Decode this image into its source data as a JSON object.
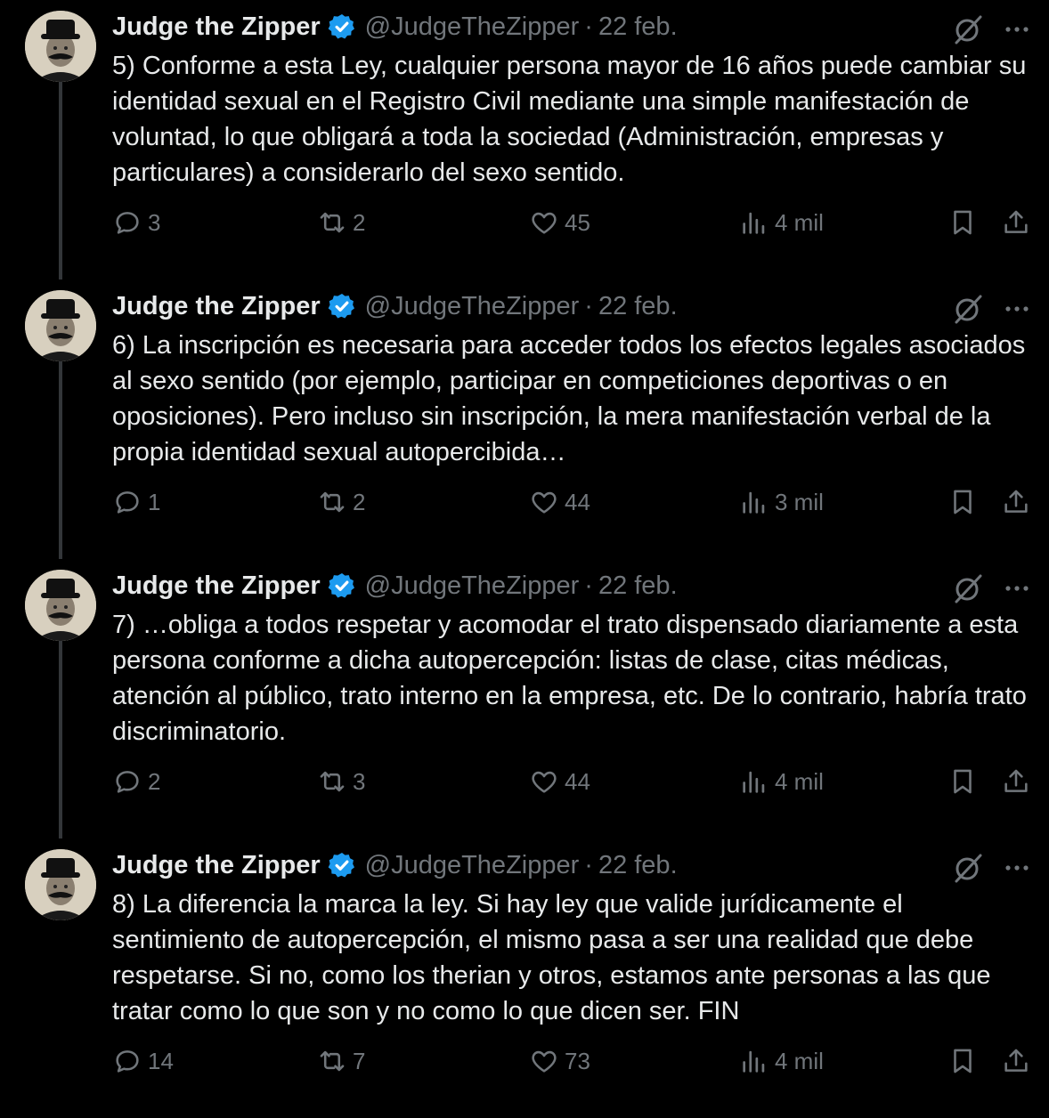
{
  "tweets": [
    {
      "name": "Judge the Zipper",
      "handle": "@JudgeTheZipper",
      "separator": "·",
      "date": "22 feb.",
      "text": "5) Conforme a esta Ley, cualquier persona mayor de 16 años puede cambiar su identidad sexual en el Registro Civil mediante una simple manifestación de voluntad, lo que obligará a toda la sociedad (Administración, empresas y particulares) a considerarlo del sexo sentido.",
      "replies": "3",
      "retweets": "2",
      "likes": "45",
      "views": "4 mil"
    },
    {
      "name": "Judge the Zipper",
      "handle": "@JudgeTheZipper",
      "separator": "·",
      "date": "22 feb.",
      "text": "6) La inscripción es necesaria para acceder todos los efectos legales asociados al sexo sentido (por ejemplo, participar en competiciones deportivas o en oposiciones). Pero incluso sin inscripción, la mera manifestación verbal de la propia identidad sexual autopercibida…",
      "replies": "1",
      "retweets": "2",
      "likes": "44",
      "views": "3 mil"
    },
    {
      "name": "Judge the Zipper",
      "handle": "@JudgeTheZipper",
      "separator": "·",
      "date": "22 feb.",
      "text": "7) …obliga a todos respetar y acomodar el trato dispensado diariamente a esta persona conforme a dicha autopercepción: listas de clase, citas médicas, atención al público, trato interno en la empresa, etc. De lo contrario, habría trato discriminatorio.",
      "replies": "2",
      "retweets": "3",
      "likes": "44",
      "views": "4 mil"
    },
    {
      "name": "Judge the Zipper",
      "handle": "@JudgeTheZipper",
      "separator": "·",
      "date": "22 feb.",
      "text": "8) La diferencia la marca la ley. Si hay ley que valide jurídicamente el sentimiento de autopercepción, el mismo pasa a ser una realidad que debe respetarse. Si no, como los therian y otros, estamos ante personas a las que tratar como lo que son y no como lo que dicen ser. FIN",
      "replies": "14",
      "retweets": "7",
      "likes": "73",
      "views": "4 mil"
    }
  ],
  "icons": {
    "avatar": "avatar-portrait",
    "verified": "verified-badge-icon",
    "grok": "grok-icon",
    "more": "more-icon",
    "reply": "reply-icon",
    "retweet": "retweet-icon",
    "like": "like-icon",
    "views": "views-icon",
    "bookmark": "bookmark-icon",
    "share": "share-icon"
  },
  "colors": {
    "background": "#000000",
    "text": "#e7e9ea",
    "muted": "#71767b",
    "verified": "#1d9bf0",
    "thread_line": "#333639"
  }
}
